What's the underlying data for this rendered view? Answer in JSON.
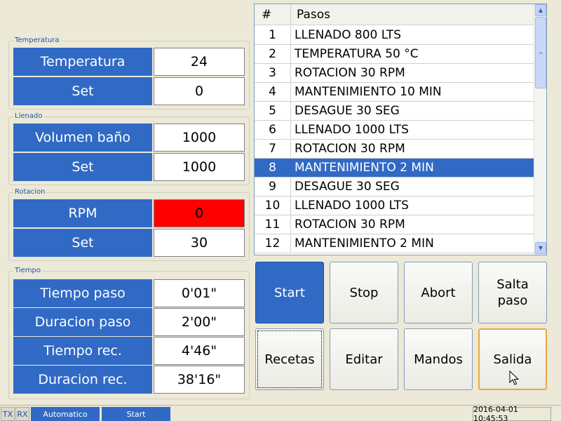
{
  "groups": {
    "temperatura": {
      "title": "Temperatura",
      "main_label": "Temperatura",
      "main_value": "24",
      "set_label": "Set",
      "set_value": "0"
    },
    "llenado": {
      "title": "Llenado",
      "main_label": "Volumen baño",
      "main_value": "1000",
      "set_label": "Set",
      "set_value": "1000"
    },
    "rotacion": {
      "title": "Rotacion",
      "main_label": "RPM",
      "main_value": "0",
      "set_label": "Set",
      "set_value": "30"
    },
    "tiempo": {
      "title": "Tiempo",
      "rows": [
        {
          "label": "Tiempo paso",
          "value": "0'01\""
        },
        {
          "label": "Duracion paso",
          "value": "2'00\""
        },
        {
          "label": "Tiempo rec.",
          "value": "4'46\""
        },
        {
          "label": "Duracion rec.",
          "value": "38'16\""
        }
      ]
    }
  },
  "steps": {
    "col_num": "#",
    "col_name": "Pasos",
    "selected": "8",
    "rows": [
      {
        "n": "1",
        "name": "LLENADO 800 LTS"
      },
      {
        "n": "2",
        "name": "TEMPERATURA 50 °C"
      },
      {
        "n": "3",
        "name": "ROTACION 30 RPM"
      },
      {
        "n": "4",
        "name": "MANTENIMIENTO 10 MIN"
      },
      {
        "n": "5",
        "name": "DESAGUE 30 SEG"
      },
      {
        "n": "6",
        "name": "LLENADO 1000 LTS"
      },
      {
        "n": "7",
        "name": "ROTACION 30 RPM"
      },
      {
        "n": "8",
        "name": "MANTENIMIENTO 2 MIN"
      },
      {
        "n": "9",
        "name": "DESAGUE 30 SEG"
      },
      {
        "n": "10",
        "name": "LLENADO 1000 LTS"
      },
      {
        "n": "11",
        "name": "ROTACION 30 RPM"
      },
      {
        "n": "12",
        "name": "MANTENIMIENTO 2 MIN"
      }
    ]
  },
  "buttons": {
    "start": "Start",
    "stop": "Stop",
    "abort": "Abort",
    "salta_paso_1": "Salta",
    "salta_paso_2": "paso",
    "recetas": "Recetas",
    "editar": "Editar",
    "mandos": "Mandos",
    "salida": "Salida"
  },
  "status_bar": {
    "tx": "TX",
    "rx": "RX",
    "mode": "Automatico",
    "state": "Start",
    "datetime": "2016-04-01 10:45:53"
  },
  "colors": {
    "label_bg": "#316ac5",
    "alarm": "#ff0000",
    "selection": "#316ac5",
    "window_bg": "#ece9d8"
  }
}
